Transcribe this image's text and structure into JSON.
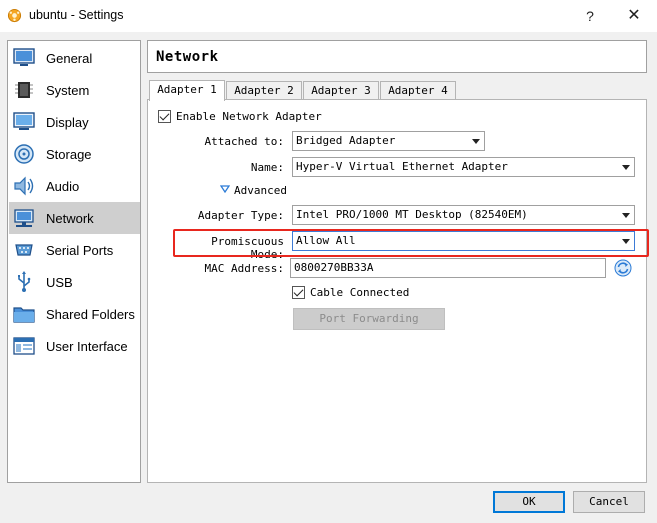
{
  "window": {
    "title": "ubuntu - Settings",
    "help": "?",
    "close": "✕"
  },
  "sidebar": {
    "items": [
      {
        "label": "General",
        "icon": "general-icon"
      },
      {
        "label": "System",
        "icon": "system-icon"
      },
      {
        "label": "Display",
        "icon": "display-icon"
      },
      {
        "label": "Storage",
        "icon": "storage-icon"
      },
      {
        "label": "Audio",
        "icon": "audio-icon"
      },
      {
        "label": "Network",
        "icon": "network-icon",
        "selected": true
      },
      {
        "label": "Serial Ports",
        "icon": "serial-ports-icon"
      },
      {
        "label": "USB",
        "icon": "usb-icon"
      },
      {
        "label": "Shared Folders",
        "icon": "shared-folders-icon"
      },
      {
        "label": "User Interface",
        "icon": "user-interface-icon"
      }
    ]
  },
  "page": {
    "title": "Network"
  },
  "tabs": [
    {
      "label": "Adapter 1",
      "selected": true
    },
    {
      "label": "Adapter 2"
    },
    {
      "label": "Adapter 3"
    },
    {
      "label": "Adapter 4"
    }
  ],
  "form": {
    "enable_label": "Enable Network Adapter",
    "enable_checked": true,
    "attached_label": "Attached to:",
    "attached_value": "Bridged Adapter",
    "name_label": "Name:",
    "name_value": "Hyper-V Virtual Ethernet Adapter",
    "advanced_label": "Advanced",
    "adapter_type_label": "Adapter Type:",
    "adapter_type_value": "Intel PRO/1000 MT Desktop (82540EM)",
    "promiscuous_label": "Promiscuous Mode:",
    "promiscuous_value": "Allow All",
    "mac_label": "MAC Address:",
    "mac_value": "0800270BB33A",
    "cable_label": "Cable Connected",
    "cable_checked": true,
    "port_forwarding_label": "Port Forwarding"
  },
  "footer": {
    "ok": "OK",
    "cancel": "Cancel"
  },
  "colors": {
    "highlight": "#e8271e",
    "focus": "#3d7bd6",
    "selection": "#cfcfcf"
  }
}
